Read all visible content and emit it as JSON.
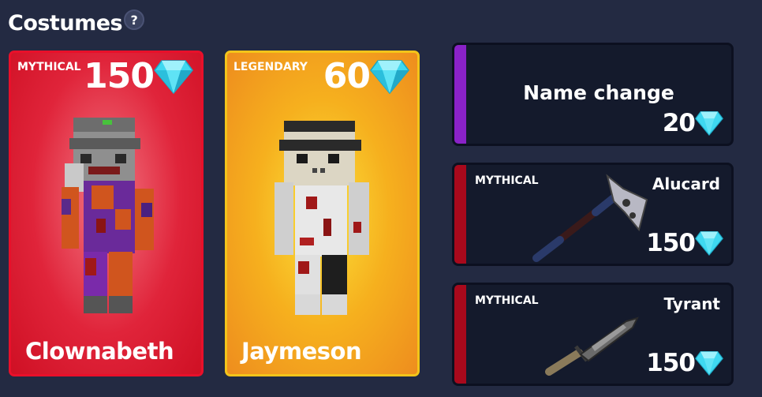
{
  "header": {
    "title": "Costumes",
    "help_label": "?"
  },
  "costumes": [
    {
      "rarity": "MYTHICAL",
      "price": "150",
      "name": "Clownabeth"
    },
    {
      "rarity": "LEGENDARY",
      "price": "60",
      "name": "Jaymeson"
    }
  ],
  "name_change": {
    "label": "Name change",
    "price": "20"
  },
  "items": [
    {
      "rarity": "MYTHICAL",
      "name": "Alucard",
      "price": "150",
      "icon": "axe-icon"
    },
    {
      "rarity": "MYTHICAL",
      "name": "Tyrant",
      "price": "150",
      "icon": "knife-icon"
    }
  ],
  "colors": {
    "background": "#232a42",
    "mythical": "#d41226",
    "legendary": "#f5b21e",
    "name_change_accent": "#8a22c8",
    "mythical_item_accent": "#a8091c",
    "gem": "#3fd8f0"
  },
  "currency_icon": "diamond-gem-icon"
}
